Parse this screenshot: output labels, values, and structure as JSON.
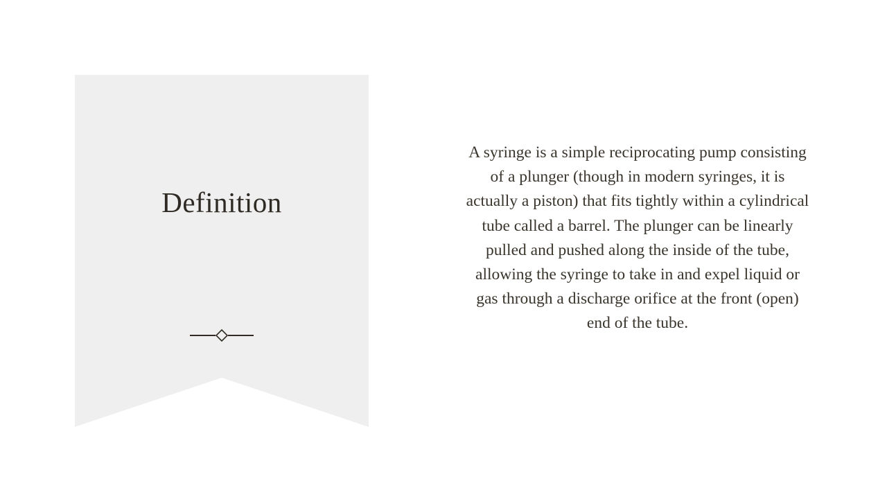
{
  "slide": {
    "title": "Definition",
    "body": "A syringe is a simple reciprocating pump consisting of a plunger (though in modern syringes, it is actually a piston) that fits tightly within a cylindrical tube called a barrel. The plunger can be linearly pulled and pushed along the inside of the tube, allowing the syringe to take in and expel liquid or gas through a discharge orifice at the front (open) end of the tube."
  },
  "colors": {
    "banner_fill": "#efeff0",
    "text": "#3a352c",
    "ornament": "#2f2b24"
  },
  "icons": {
    "divider": "diamond-divider-icon"
  }
}
